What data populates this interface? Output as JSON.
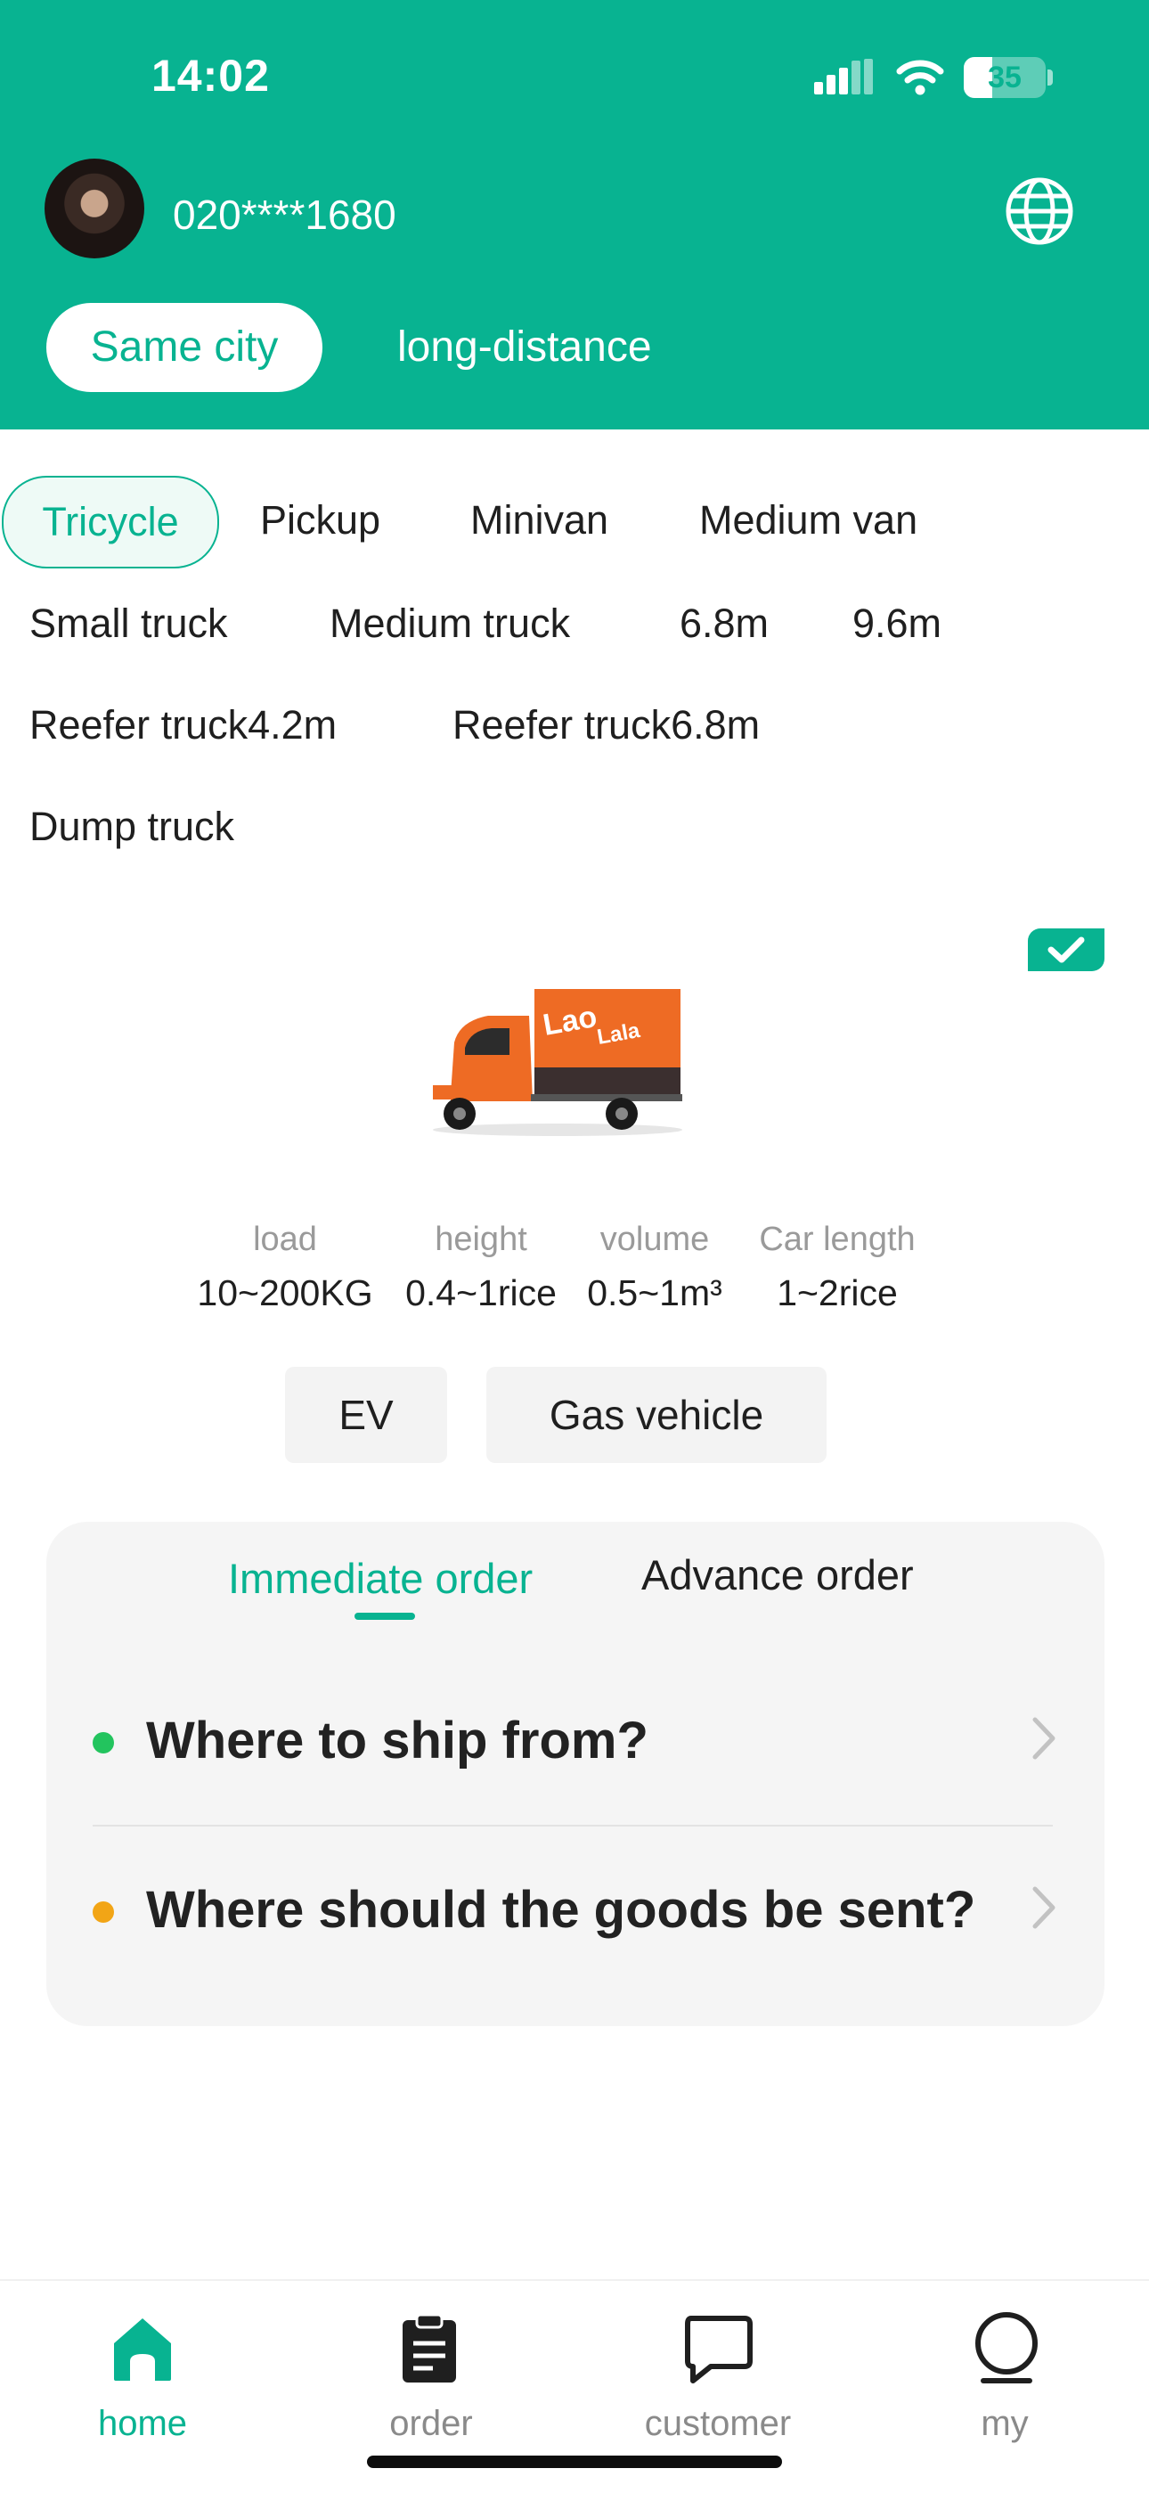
{
  "status_bar": {
    "time": "14:02",
    "battery": "35",
    "battery_level": 0.35
  },
  "header": {
    "phone": "020****1680",
    "scope_tabs": [
      {
        "label": "Same city",
        "active": true
      },
      {
        "label": "long-distance",
        "active": false
      }
    ]
  },
  "vehicle_types": [
    {
      "label": "Tricycle",
      "active": true
    },
    {
      "label": "Pickup"
    },
    {
      "label": "Minivan"
    },
    {
      "label": "Medium van"
    },
    {
      "label": "Small truck"
    },
    {
      "label": "Medium truck"
    },
    {
      "label": "6.8m"
    },
    {
      "label": "9.6m"
    },
    {
      "label": "Reefer truck4.2m"
    },
    {
      "label": "Reefer truck6.8m"
    },
    {
      "label": "Dump truck"
    }
  ],
  "vehicle": {
    "brand_line1": "Lao",
    "brand_line2": "Lala",
    "specs": [
      {
        "label": "load",
        "value": "10~200KG"
      },
      {
        "label": "height",
        "value": "0.4~1rice"
      },
      {
        "label": "volume",
        "value": "0.5~1m³"
      },
      {
        "label": "Car length",
        "value": "1~2rice"
      }
    ],
    "energy_options": [
      "EV",
      "Gas vehicle"
    ]
  },
  "order": {
    "tabs": [
      {
        "label": "Immediate order",
        "active": true
      },
      {
        "label": "Advance order",
        "active": false
      }
    ],
    "from_prompt": "Where to ship from?",
    "to_prompt": "Where should the goods be sent?"
  },
  "nav": {
    "items": [
      {
        "label": "home",
        "active": true,
        "icon": "home-icon"
      },
      {
        "label": "order",
        "active": false,
        "icon": "clipboard-icon"
      },
      {
        "label": "customer",
        "active": false,
        "icon": "chat-icon"
      },
      {
        "label": "my",
        "active": false,
        "icon": "person-icon"
      }
    ]
  },
  "colors": {
    "accent": "#08b391",
    "from_dot": "#23c45e",
    "to_dot": "#f2a516",
    "inactive": "#8a8a8a"
  }
}
